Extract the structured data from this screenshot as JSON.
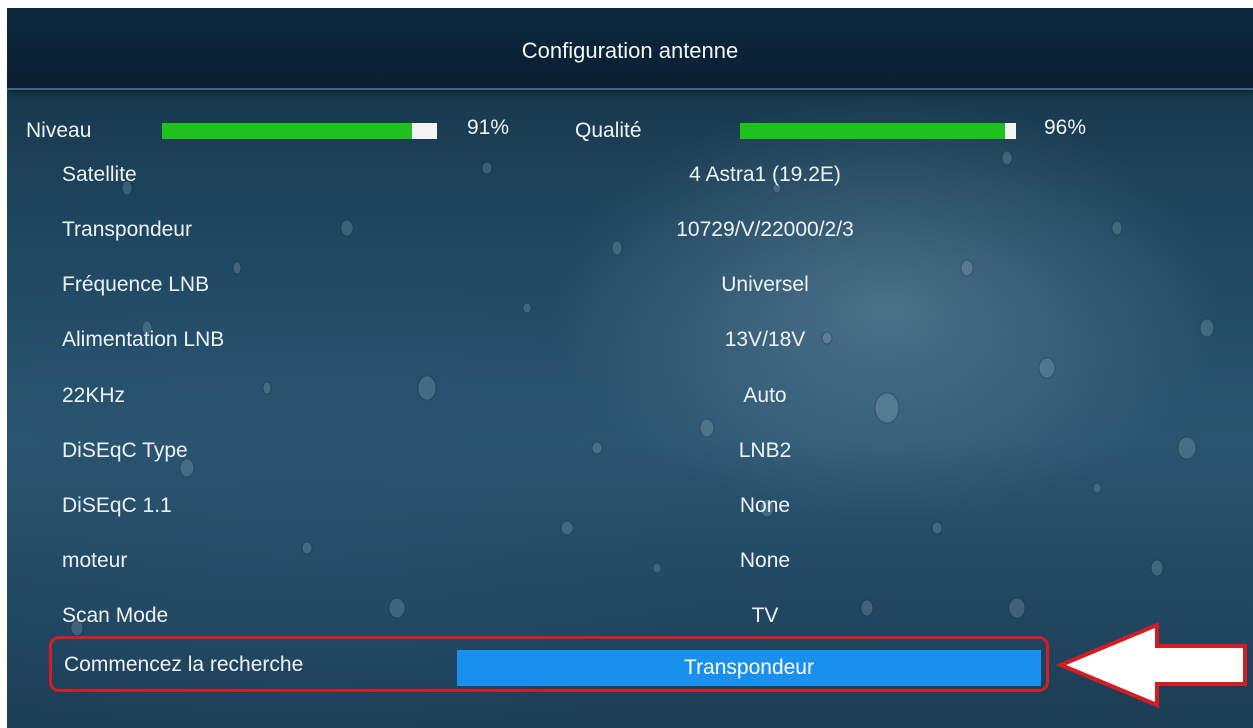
{
  "header": {
    "title": "Configuration antenne"
  },
  "signal": {
    "level": {
      "label": "Niveau",
      "percent_text": "91%",
      "value": 0.91
    },
    "quality": {
      "label": "Qualité",
      "percent_text": "96%",
      "value": 0.96
    }
  },
  "settings": [
    {
      "label": "Satellite",
      "value": "4 Astra1 (19.2E)"
    },
    {
      "label": "Transpondeur",
      "value": "10729/V/22000/2/3"
    },
    {
      "label": "Fréquence LNB",
      "value": "Universel"
    },
    {
      "label": "Alimentation LNB",
      "value": "13V/18V"
    },
    {
      "label": "22KHz",
      "value": "Auto"
    },
    {
      "label": "DiSEqC Type",
      "value": "LNB2"
    },
    {
      "label": "DiSEqC 1.1",
      "value": "None"
    },
    {
      "label": "moteur",
      "value": "None"
    },
    {
      "label": "Scan Mode",
      "value": "TV"
    }
  ],
  "action": {
    "label": "Commencez la recherche",
    "button": "Transpondeur"
  },
  "colors": {
    "highlight_border": "#d41c25",
    "selected": "#1a90ee",
    "signal_green": "#1fc21c"
  },
  "annotation": {
    "icon": "arrow-left-icon"
  }
}
